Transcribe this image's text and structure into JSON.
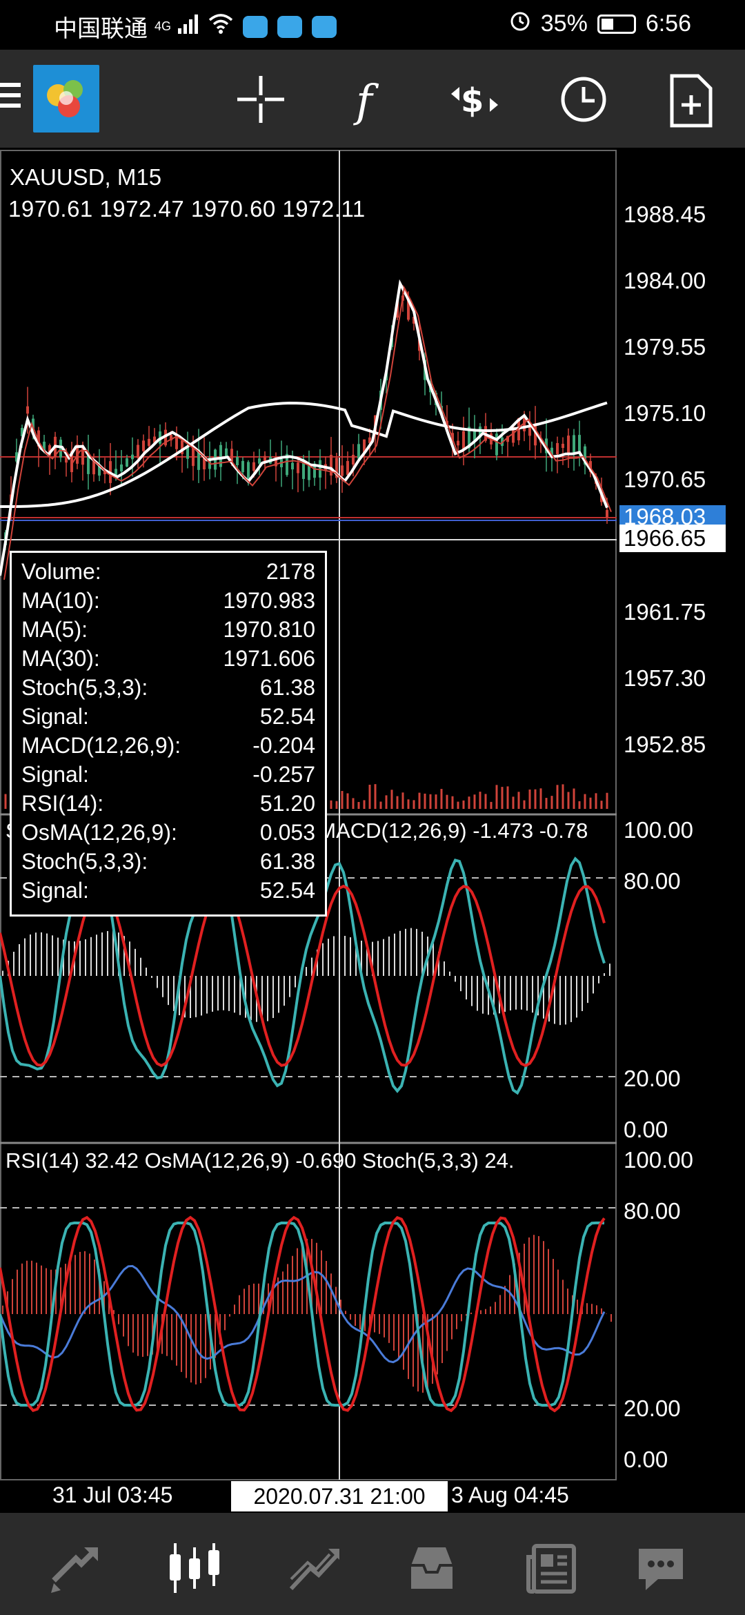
{
  "status_bar": {
    "carrier": "中国联通",
    "network": "4G",
    "battery": "35%",
    "time": "6:56"
  },
  "toolbar": {
    "icons": [
      "menu-icon",
      "mt5-logo",
      "crosshair-icon",
      "indicators-icon",
      "trade-icon",
      "history-clock-icon",
      "new-order-icon"
    ]
  },
  "chart": {
    "symbol": "XAUUSD, M15",
    "ohlc": "1970.61 1972.47 1970.60 1972.11",
    "price_axis": [
      "1988.45",
      "1984.00",
      "1979.55",
      "1975.10",
      "1970.65",
      "1961.75",
      "1957.30",
      "1952.85"
    ],
    "bid_tag": "1968.03",
    "cursor_price": "1966.65",
    "indicator1_header": "Stoch(5,3,3) 61.38 Signal: 52.54 MACD(12,26,9) -1.473 -0.78",
    "indicator1_axis": [
      "100.00",
      "80.00",
      "20.00",
      "0.00"
    ],
    "indicator2_header": "RSI(14) 32.42 OsMA(12,26,9) -0.690 Stoch(5,3,3) 24.",
    "indicator2_axis": [
      "100.00",
      "80.00",
      "20.00",
      "0.00"
    ],
    "time_labels": [
      "31 Jul 03:45",
      "3 Aug 04:45"
    ],
    "time_cursor": "2020.07.31 21:00"
  },
  "data_window": {
    "rows": [
      {
        "label": "Volume:",
        "value": "2178"
      },
      {
        "label": "MA(10):",
        "value": "1970.983"
      },
      {
        "label": "MA(5):",
        "value": "1970.810"
      },
      {
        "label": "MA(30):",
        "value": "1971.606"
      },
      {
        "label": "Stoch(5,3,3):",
        "value": "61.38"
      },
      {
        "label": "Signal:",
        "value": "52.54"
      },
      {
        "label": "MACD(12,26,9):",
        "value": "-0.204"
      },
      {
        "label": "Signal:",
        "value": "-0.257"
      },
      {
        "label": "RSI(14):",
        "value": "51.20"
      },
      {
        "label": "OsMA(12,26,9):",
        "value": "0.053"
      },
      {
        "label": "Stoch(5,3,3):",
        "value": "61.38"
      },
      {
        "label": "Signal:",
        "value": "52.54"
      }
    ]
  },
  "bottom_nav": {
    "items": [
      "quotes-icon",
      "chart-icon",
      "trade-icon",
      "history-icon",
      "news-icon",
      "messages-icon"
    ],
    "active": "chart-icon"
  },
  "colors": {
    "toolbar_bg": "#2b2b2b",
    "bull": "#3fa87a",
    "bear": "#d0433a",
    "ma_white": "#ffffff",
    "stoch_teal": "#3bb3b3",
    "signal_red": "#e02020",
    "rsi_blue": "#4a7bd8",
    "bid_blue": "#2e7fd8"
  }
}
